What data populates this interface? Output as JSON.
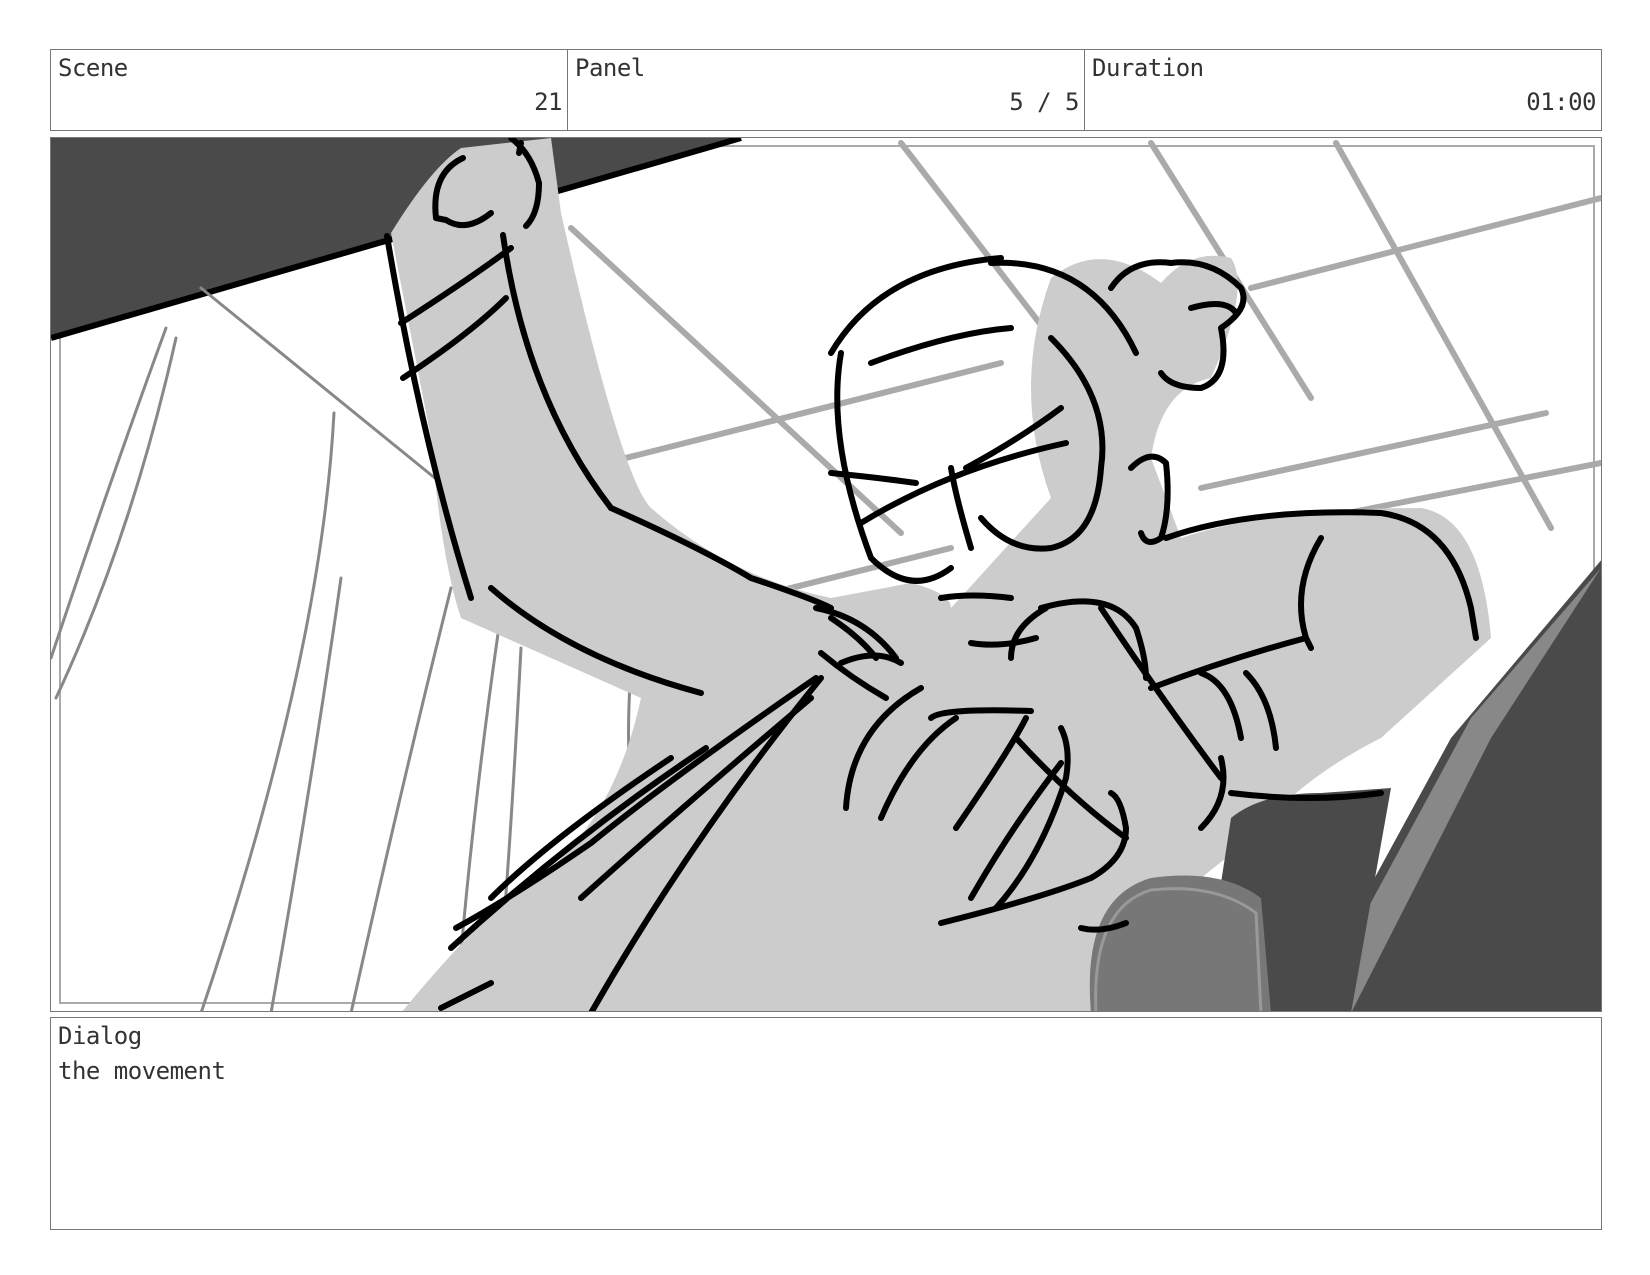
{
  "header": {
    "scene_label": "Scene",
    "scene_value": "21",
    "panel_label": "Panel",
    "panel_value": "5 / 5",
    "duration_label": "Duration",
    "duration_value": "01:00"
  },
  "dialog": {
    "label": "Dialog",
    "text": "the movement"
  },
  "colors": {
    "border": "#777777",
    "fill_light": "#cccccc",
    "fill_dark": "#4a4a4a",
    "line": "#000000",
    "grid": "#aaaaaa"
  }
}
